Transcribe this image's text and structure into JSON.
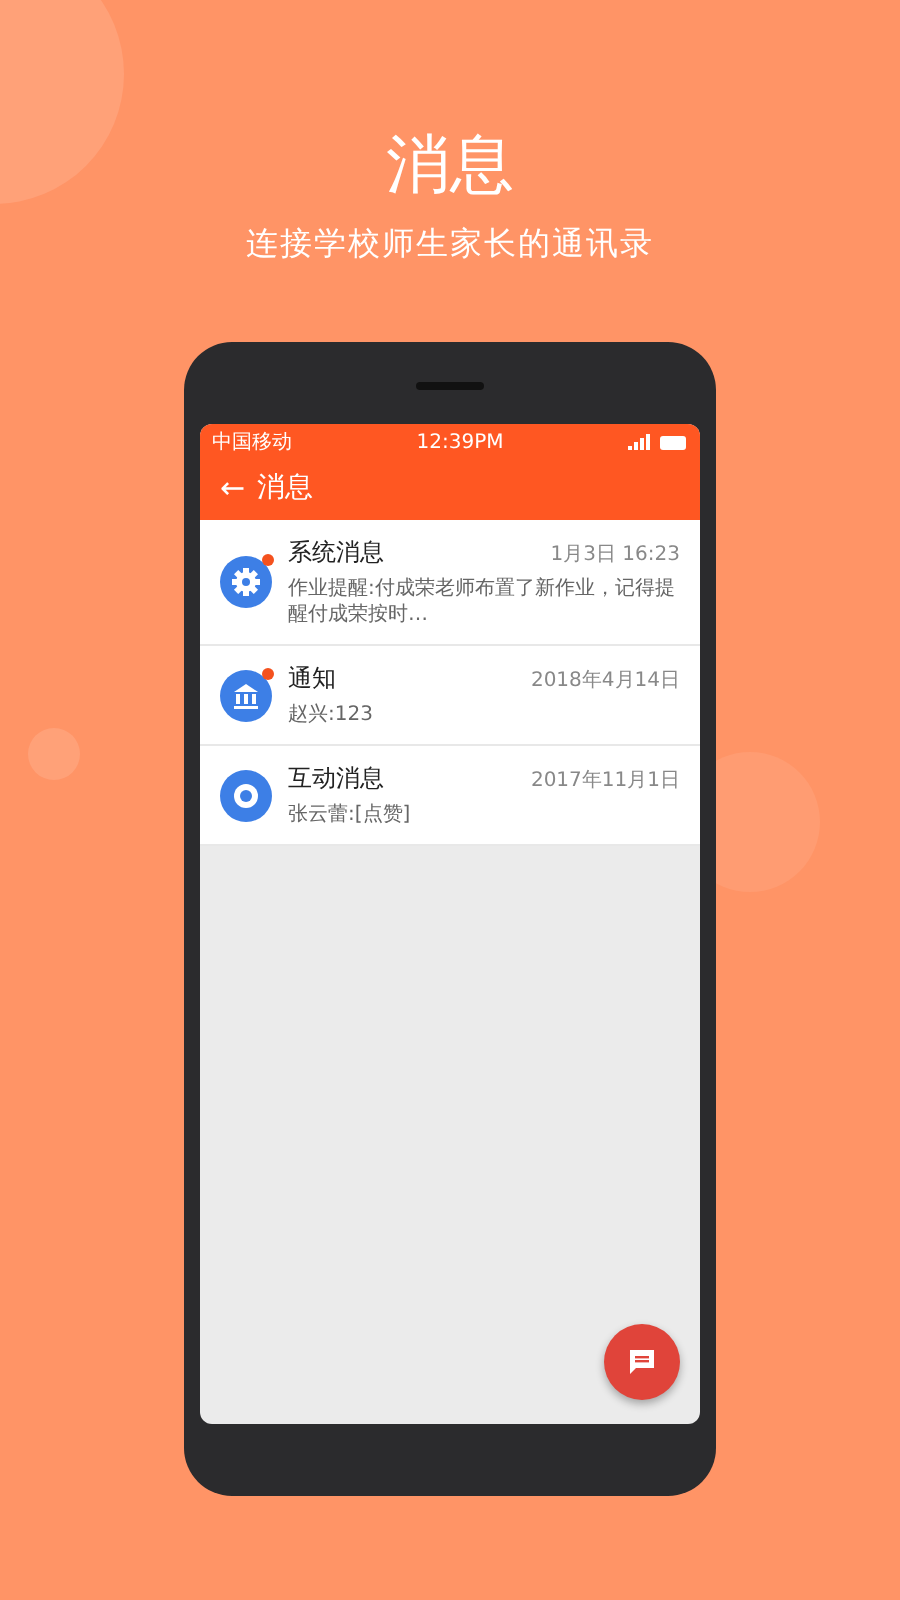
{
  "headline": {
    "title": "消息",
    "subtitle": "连接学校师生家长的通讯录"
  },
  "status_bar": {
    "carrier": "中国移动",
    "time": "12:39PM"
  },
  "app_bar": {
    "back": "←",
    "title": "消息"
  },
  "messages": [
    {
      "kind": "gear",
      "title": "系统消息",
      "time": "1月3日 16:23",
      "preview": "作业提醒:付成荣老师布置了新作业，记得提醒付成荣按时…",
      "unread": true
    },
    {
      "kind": "bank",
      "title": "通知",
      "time": "2018年4月14日",
      "preview": "赵兴:123",
      "unread": true
    },
    {
      "kind": "ring",
      "title": "互动消息",
      "time": "2017年11月1日",
      "preview": "张云蕾:[点赞]",
      "unread": false
    }
  ]
}
